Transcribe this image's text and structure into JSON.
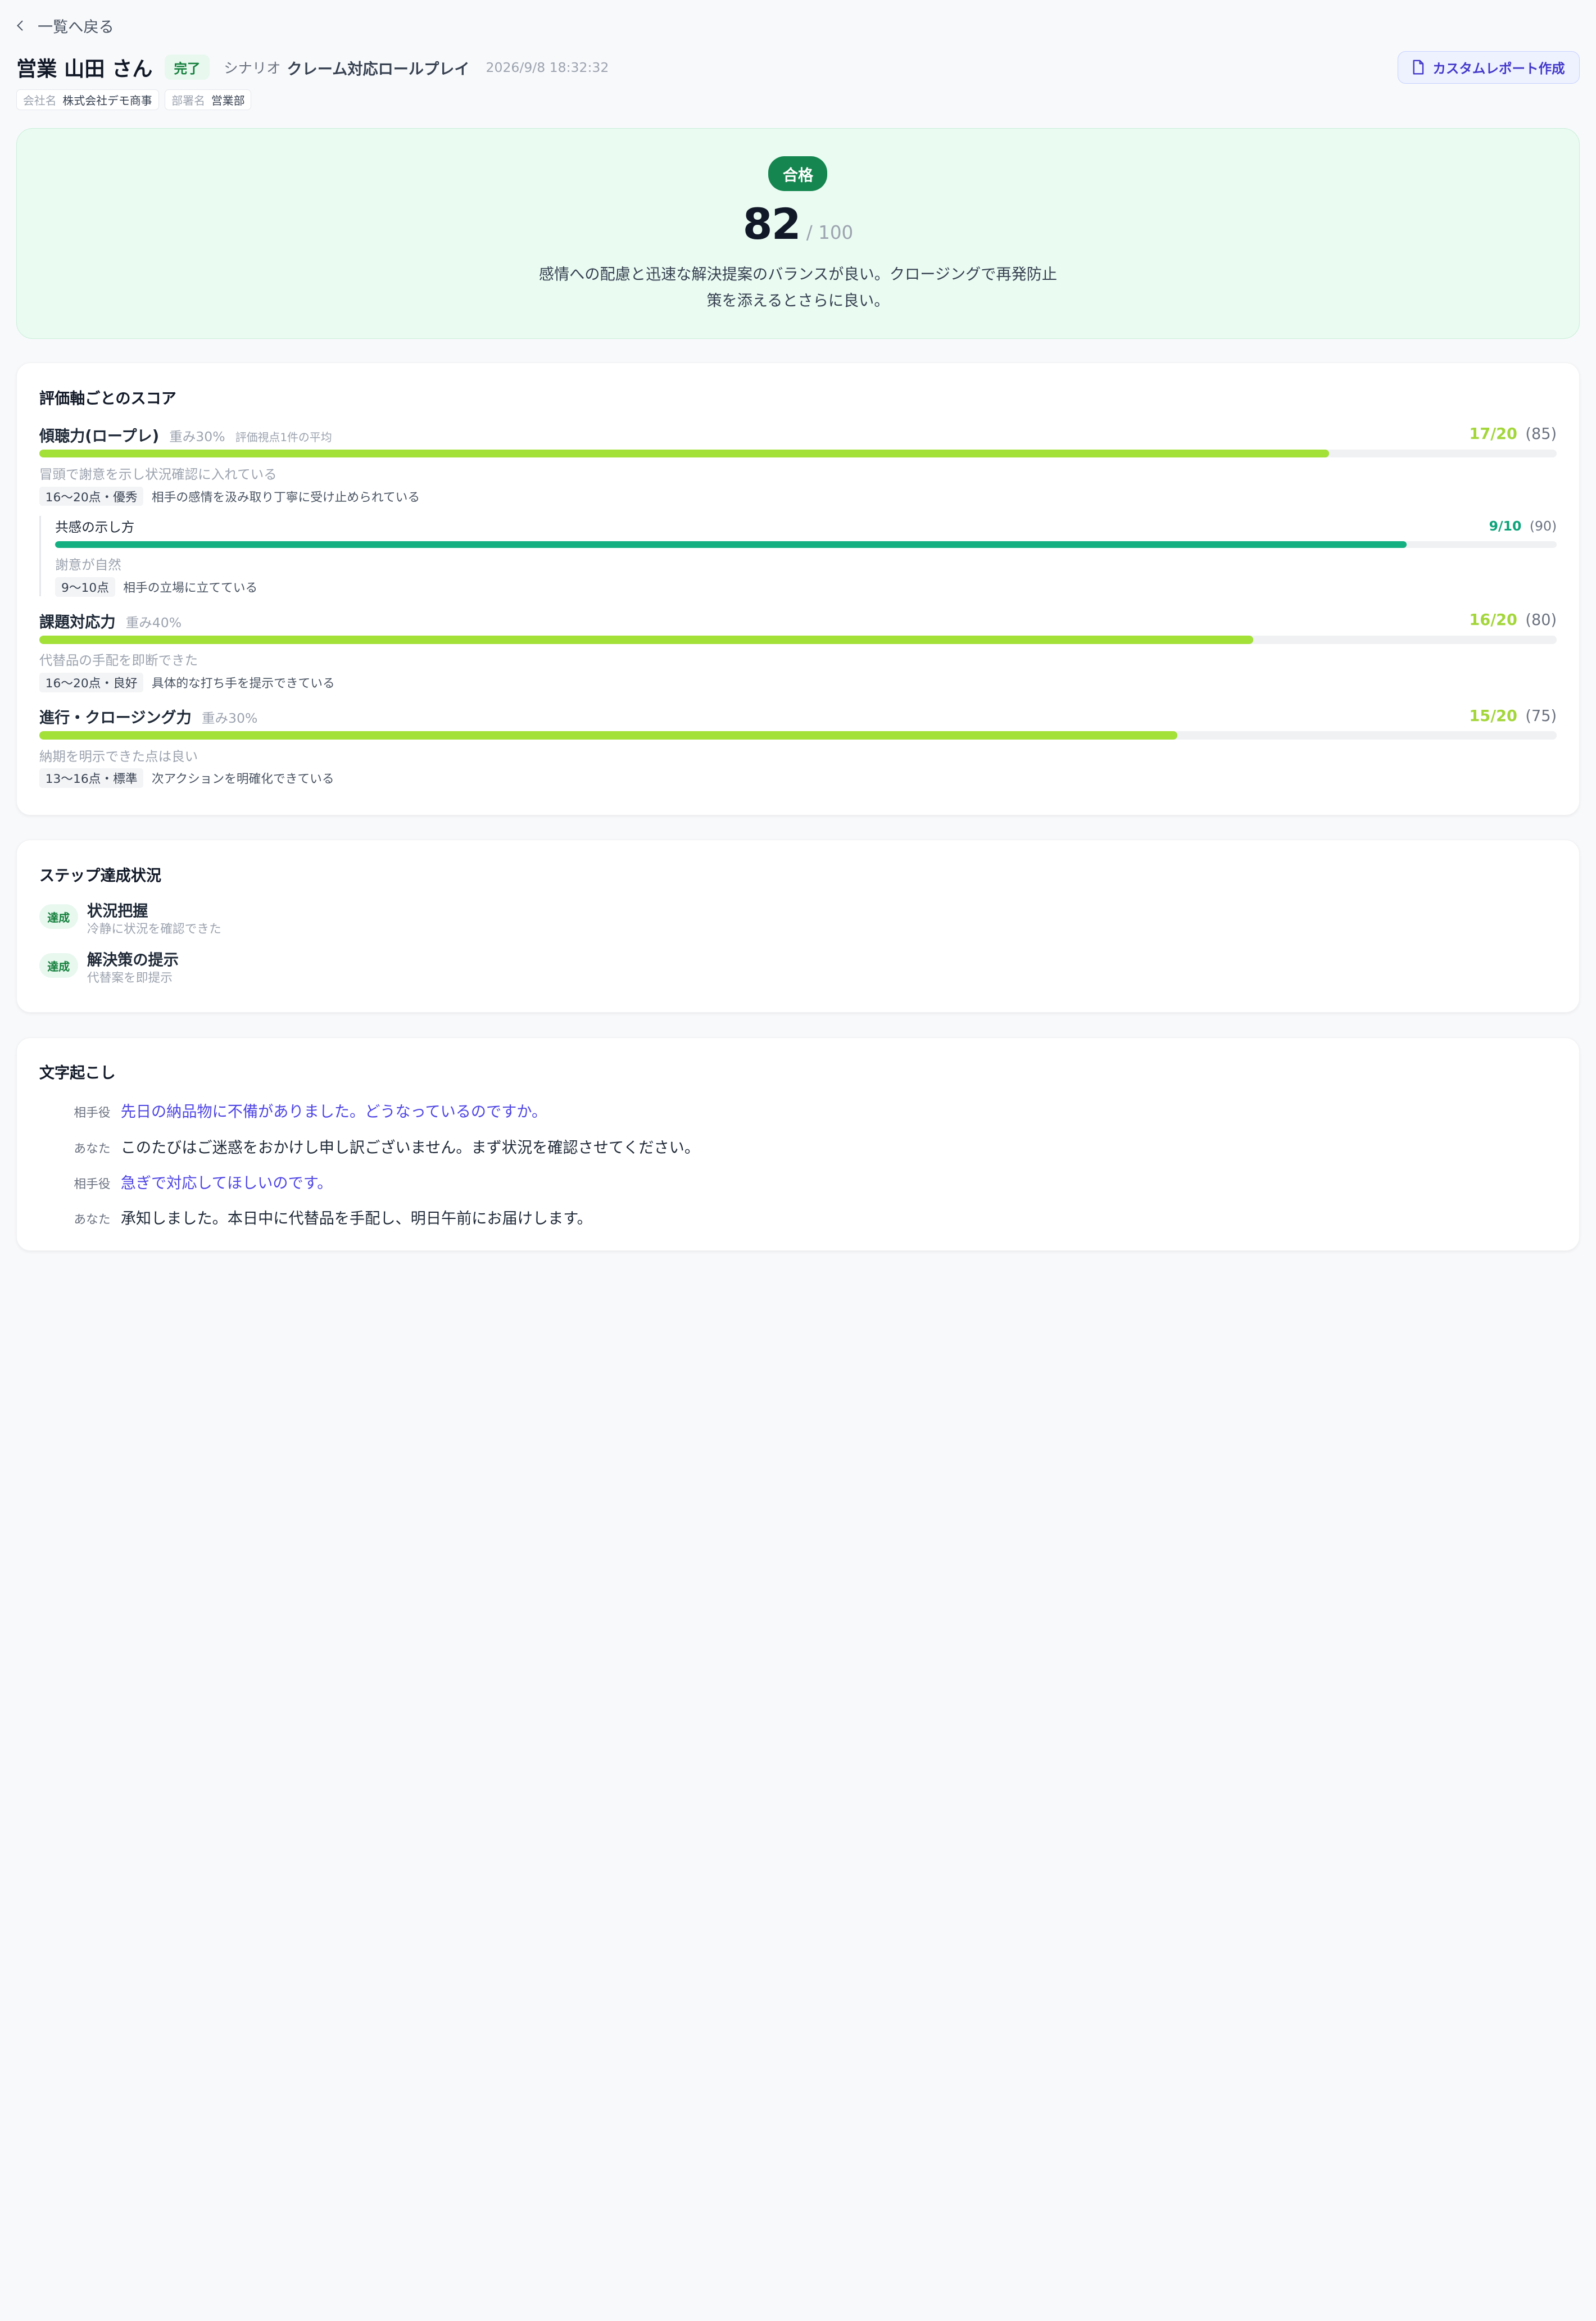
{
  "nav": {
    "back_label": "一覧へ戻る"
  },
  "header": {
    "name": "営業 山田 さん",
    "status": "完了",
    "scenario_label": "シナリオ",
    "scenario_name": "クレーム対応ロールプレイ",
    "datetime": "2026/9/8 18:32:32",
    "report_button": "カスタムレポート作成"
  },
  "chips": [
    {
      "key": "会社名",
      "value": "株式会社デモ商事"
    },
    {
      "key": "部署名",
      "value": "営業部"
    }
  ],
  "result": {
    "verdict": "合格",
    "score": "82",
    "max": "/ 100",
    "summary": "感情への配慮と迅速な解決提案のバランスが良い。クロージングで再発防止策を添えるとさらに良い。"
  },
  "scores": {
    "title": "評価軸ごとのスコア",
    "axes": [
      {
        "name": "傾聴力(ロープレ)",
        "weight": "重み30%",
        "note": "評価視点1件の平均",
        "score": "17/20",
        "pct": "(85)",
        "fill": 0.85,
        "comment": "冒頭で謝意を示し状況確認に入れている",
        "band": "16〜20点・優秀",
        "band_desc": "相手の感情を汲み取り丁寧に受け止められている",
        "sub": {
          "name": "共感の示し方",
          "score": "9/10",
          "pct": "(90)",
          "fill": 0.9,
          "comment": "謝意が自然",
          "band": "9〜10点",
          "band_desc": "相手の立場に立てている"
        }
      },
      {
        "name": "課題対応力",
        "weight": "重み40%",
        "score": "16/20",
        "pct": "(80)",
        "fill": 0.8,
        "comment": "代替品の手配を即断できた",
        "band": "16〜20点・良好",
        "band_desc": "具体的な打ち手を提示できている"
      },
      {
        "name": "進行・クロージング力",
        "weight": "重み30%",
        "score": "15/20",
        "pct": "(75)",
        "fill": 0.75,
        "comment": "納期を明示できた点は良い",
        "band": "13〜16点・標準",
        "band_desc": "次アクションを明確化できている"
      }
    ]
  },
  "steps": {
    "title": "ステップ達成状況",
    "items": [
      {
        "badge": "達成",
        "name": "状況把握",
        "desc": "冷静に状況を確認できた"
      },
      {
        "badge": "達成",
        "name": "解決策の提示",
        "desc": "代替案を即提示"
      }
    ]
  },
  "transcript": {
    "title": "文字起こし",
    "lines": [
      {
        "speaker": "相手役",
        "text": "先日の納品物に不備がありました。どうなっているのですか。"
      },
      {
        "speaker": "あなた",
        "text": "このたびはご迷惑をおかけし申し訳ございません。まず状況を確認させてください。"
      },
      {
        "speaker": "相手役",
        "text": "急ぎで対応してほしいのです。"
      },
      {
        "speaker": "あなた",
        "text": "承知しました。本日中に代替品を手配し、明日午前にお届けします。"
      }
    ]
  }
}
